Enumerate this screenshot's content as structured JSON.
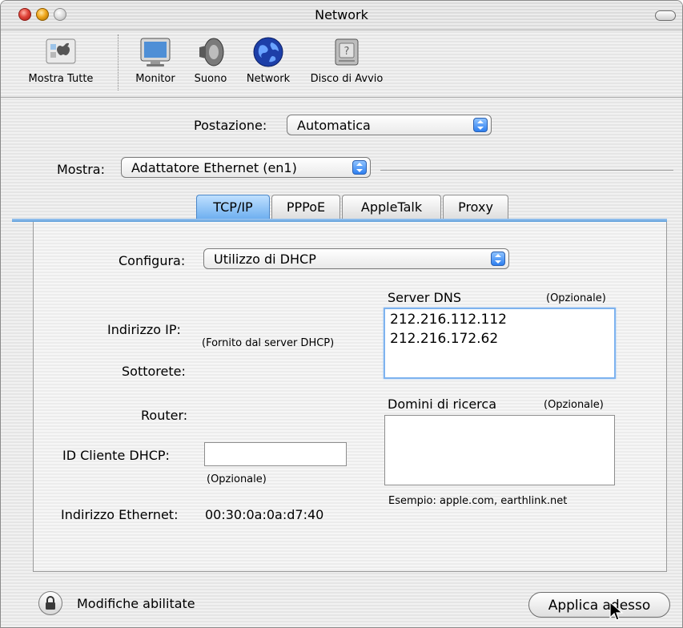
{
  "window": {
    "title": "Network"
  },
  "toolbar": {
    "items": [
      {
        "label": "Mostra Tutte",
        "icon": "show-all-icon"
      },
      {
        "label": "Monitor",
        "icon": "monitor-icon"
      },
      {
        "label": "Suono",
        "icon": "speaker-icon"
      },
      {
        "label": "Network",
        "icon": "globe-icon"
      },
      {
        "label": "Disco di Avvio",
        "icon": "hard-disk-icon"
      }
    ]
  },
  "location": {
    "label": "Postazione:",
    "value": "Automatica"
  },
  "show": {
    "label": "Mostra:",
    "value": "Adattatore Ethernet (en1)"
  },
  "tabs": [
    {
      "label": "TCP/IP",
      "active": true
    },
    {
      "label": "PPPoE",
      "active": false
    },
    {
      "label": "AppleTalk",
      "active": false
    },
    {
      "label": "Proxy",
      "active": false
    }
  ],
  "tcpip": {
    "configure_label": "Configura:",
    "configure_value": "Utilizzo di DHCP",
    "ip_label": "Indirizzo IP:",
    "ip_note": "(Fornito dal server DHCP)",
    "subnet_label": "Sottorete:",
    "router_label": "Router:",
    "dhcp_client_label": "ID Cliente DHCP:",
    "dhcp_client_value": "",
    "dhcp_client_note": "(Opzionale)",
    "ethernet_label": "Indirizzo Ethernet:",
    "ethernet_value": "00:30:0a:0a:d7:40",
    "dns_label": "Server DNS",
    "dns_optional": "(Opzionale)",
    "dns_servers": [
      "212.216.112.112",
      "212.216.172.62"
    ],
    "search_label": "Domini di ricerca",
    "search_optional": "(Opzionale)",
    "search_value": "",
    "search_example": "Esempio: apple.com, earthlink.net"
  },
  "footer": {
    "lock_text": "Modifiche abilitate",
    "apply_label": "Applica adesso"
  },
  "colors": {
    "accent": "#2e7ff0",
    "tab_active": "#6fb0f0"
  }
}
